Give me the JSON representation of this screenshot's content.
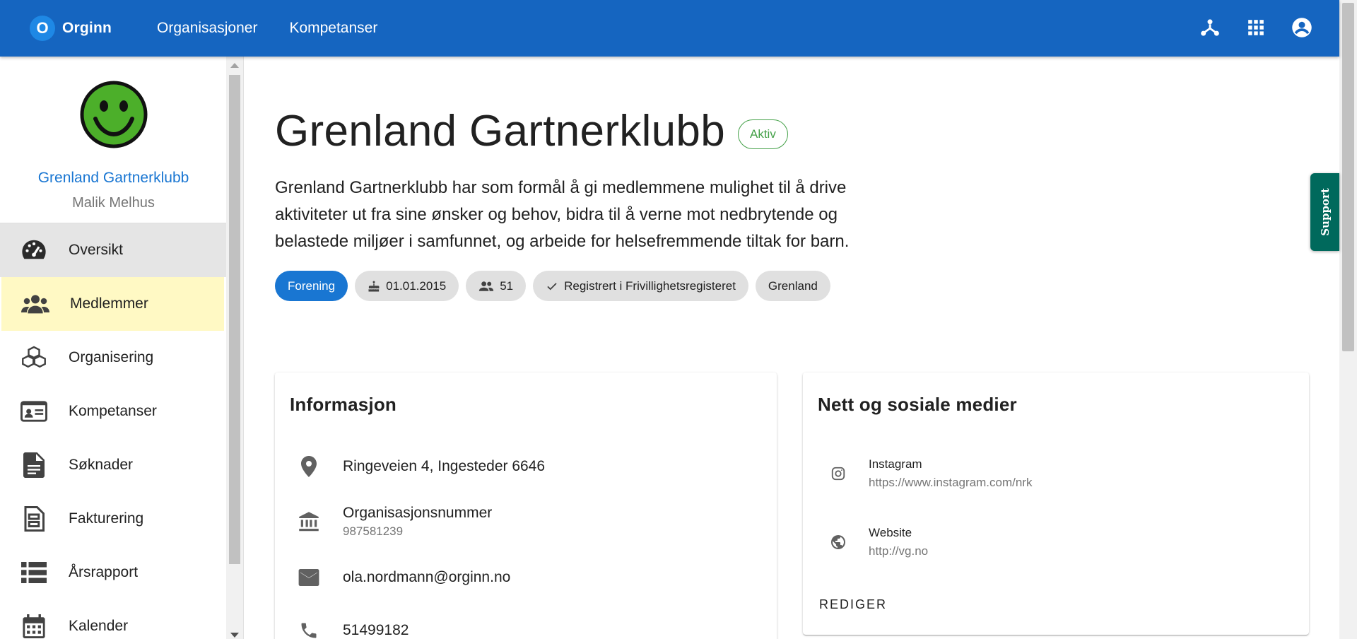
{
  "brand": {
    "logo_letter": "O",
    "name": "Orginn"
  },
  "topnav": {
    "items": [
      "Organisasjoner",
      "Kompetanser"
    ]
  },
  "top_icons": [
    "hierarchy-icon",
    "apps-grid-icon",
    "account-circle-icon"
  ],
  "sidebar": {
    "org_name": "Grenland Gartnerklubb",
    "user_name": "Malik Melhus",
    "items": [
      {
        "label": "Oversikt",
        "icon": "speedometer-icon"
      },
      {
        "label": "Medlemmer",
        "icon": "group-icon"
      },
      {
        "label": "Organisering",
        "icon": "cubes-icon"
      },
      {
        "label": "Kompetanser",
        "icon": "id-card-icon"
      },
      {
        "label": "Søknader",
        "icon": "document-icon"
      },
      {
        "label": "Fakturering",
        "icon": "invoice-icon"
      },
      {
        "label": "Årsrapport",
        "icon": "list-icon"
      },
      {
        "label": "Kalender",
        "icon": "calendar-icon"
      }
    ]
  },
  "main": {
    "title": "Grenland Gartnerklubb",
    "status": "Aktiv",
    "description": "Grenland Gartnerklubb har som formål å gi medlemmene mulighet til å drive aktiviteter ut fra sine ønsker og behov, bidra til å verne mot nedbrytende og belastede miljøer i samfunnet, og arbeide for helsefremmende tiltak for barn.",
    "chips": {
      "type": "Forening",
      "founded": "01.01.2015",
      "members": "51",
      "registered": "Registrert i Frivillighetsregisteret",
      "region": "Grenland"
    }
  },
  "info_card": {
    "title": "Informasjon",
    "address": "Ringeveien 4, Ingesteder 6646",
    "org_number_label": "Organisasjonsnummer",
    "org_number": "987581239",
    "email": "ola.nordmann@orginn.no",
    "phone": "51499182"
  },
  "social_card": {
    "title": "Nett og sosiale medier",
    "instagram_label": "Instagram",
    "instagram_url": "https://www.instagram.com/nrk",
    "website_label": "Website",
    "website_url": "http://vg.no",
    "edit_label": "REDIGER"
  },
  "support": {
    "label": "Support"
  },
  "colors": {
    "primary": "#1565c0",
    "accent": "#1976d2",
    "status_green": "#43a047",
    "support_teal": "#00695c",
    "hover_yellow": "#fff9c4"
  }
}
